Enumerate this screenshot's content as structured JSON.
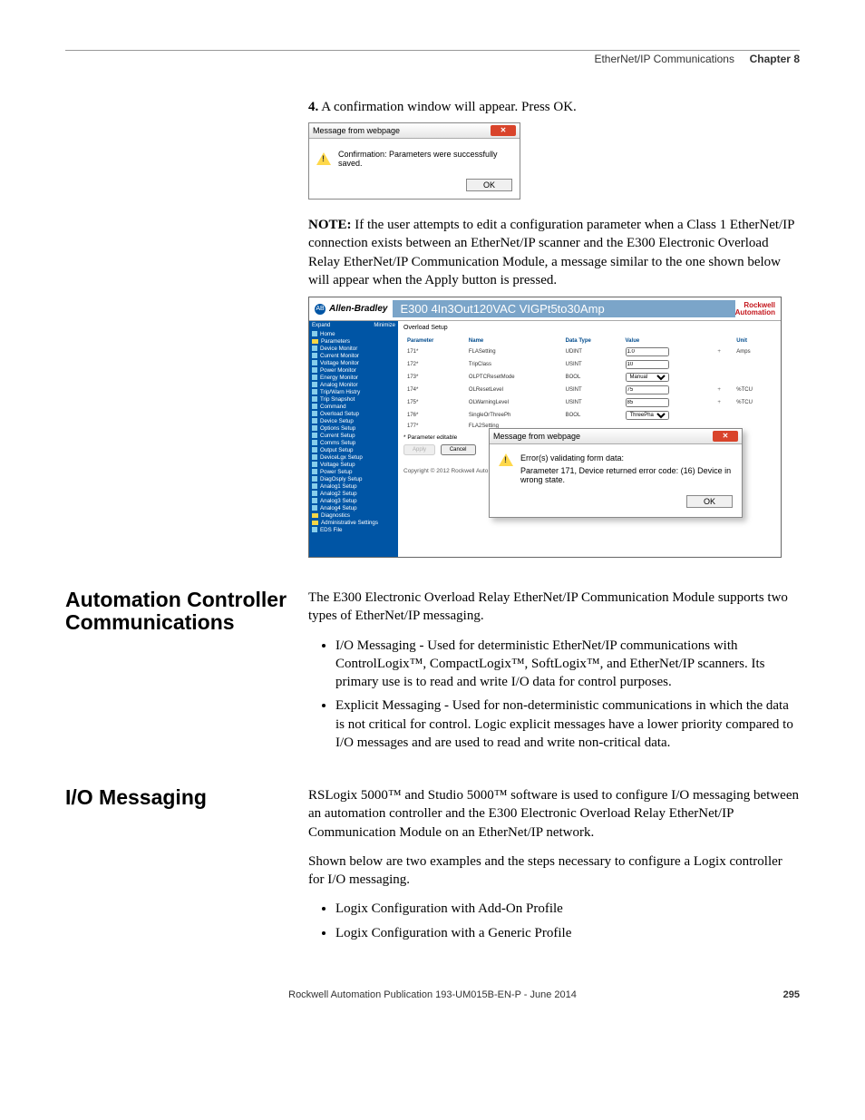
{
  "header": {
    "breadcrumb": "EtherNet/IP Communications",
    "chapter": "Chapter 8"
  },
  "step4": {
    "num": "4.",
    "text": "A confirmation window will appear. Press OK."
  },
  "dialog1": {
    "title": "Message from webpage",
    "message": "Confirmation: Parameters were successfully saved.",
    "ok": "OK"
  },
  "note": {
    "label": "NOTE:",
    "text": " If the user attempts to edit a configuration parameter when a Class 1 EtherNet/IP connection exists between an EtherNet/IP scanner and the E300 Electronic Overload Relay EtherNet/IP Communication Module, a message similar to the one shown below will appear when the Apply button is pressed."
  },
  "ss2": {
    "brand": "Allen-Bradley",
    "product": "E300 4In3Out120VAC VIGPt5to30Amp",
    "ra1": "Rockwell",
    "ra2": "Automation",
    "sidebar": {
      "expand": "Expand",
      "minimize": "Minimize",
      "home": "Home",
      "parameters": "Parameters",
      "items_monitor": [
        "Device Monitor",
        "Current Monitor",
        "Voltage Monitor",
        "Power Monitor",
        "Energy Monitor",
        "Analog Monitor",
        "Trip/Warn Histry",
        "Trip Snapshot"
      ],
      "command": "Command",
      "items_setup": [
        "Overload Setup",
        "Device Setup",
        "Options Setup",
        "Current Setup",
        "Comms Setup",
        "Output Setup",
        "DeviceLgx Setup",
        "Voltage Setup",
        "Power Setup",
        "DiagOsply Setup",
        "Analog1 Setup",
        "Analog2 Setup",
        "Analog3 Setup",
        "Analog4 Setup"
      ],
      "diagnostics": "Diagnostics",
      "admin": "Administrative Settings",
      "eds": "EDS File"
    },
    "main": {
      "title": "Overload Setup",
      "headers": {
        "param": "Parameter",
        "name": "Name",
        "datatype": "Data Type",
        "value": "Value",
        "unit": "Unit"
      },
      "rows": [
        {
          "p": "171*",
          "n": "FLASetting",
          "dt": "UDINT",
          "v": "1.0",
          "vt": "text",
          "u": "Amps"
        },
        {
          "p": "172*",
          "n": "TripClass",
          "dt": "USINT",
          "v": "10",
          "vt": "text",
          "u": ""
        },
        {
          "p": "173*",
          "n": "OLPTCResetMode",
          "dt": "BOOL",
          "v": "Manual",
          "vt": "select",
          "u": ""
        },
        {
          "p": "174*",
          "n": "OLResetLevel",
          "dt": "USINT",
          "v": "75",
          "vt": "text",
          "u": "%TCU"
        },
        {
          "p": "175*",
          "n": "OLWarningLevel",
          "dt": "USINT",
          "v": "85",
          "vt": "text",
          "u": "%TCU"
        },
        {
          "p": "176*",
          "n": "SingleOrThreePh",
          "dt": "BOOL",
          "v": "ThreePhase",
          "vt": "select",
          "u": ""
        },
        {
          "p": "177*",
          "n": "FLA2Setting",
          "dt": "",
          "v": "",
          "vt": "",
          "u": ""
        }
      ],
      "editnote": "* Parameter editable",
      "apply": "Apply",
      "cancel": "Cancel",
      "copyright": "Copyright © 2012 Rockwell Auto"
    },
    "error": {
      "title": "Message from webpage",
      "line1": "Error(s) validating form data:",
      "line2": "Parameter 171, Device returned error code: (16) Device in wrong state.",
      "ok": "OK"
    }
  },
  "sec1": {
    "heading": "Automation Controller Communications",
    "p1": "The E300 Electronic Overload Relay EtherNet/IP Communication Module supports two types of EtherNet/IP messaging.",
    "b1": "I/O Messaging - Used for deterministic EtherNet/IP communications with ControlLogix™, CompactLogix™, SoftLogix™, and EtherNet/IP scanners. Its primary use is to read and write I/O data for control purposes.",
    "b2": "Explicit Messaging - Used for non-deterministic communications in which the data is not critical for control. Logic explicit messages have a lower priority compared to I/O messages and are used to read and write non-critical data."
  },
  "sec2": {
    "heading": "I/O Messaging",
    "p1": "RSLogix 5000™ and Studio 5000™ software is used to configure I/O messaging between an automation controller and the E300 Electronic Overload Relay EtherNet/IP Communication Module on an EtherNet/IP network.",
    "p2": "Shown below are two examples and the steps necessary to configure a Logix controller for I/O messaging.",
    "b1": "Logix Configuration with Add-On Profile",
    "b2": "Logix Configuration with a Generic Profile"
  },
  "footer": {
    "pub": "Rockwell Automation Publication 193-UM015B-EN-P - June 2014",
    "page": "295"
  }
}
